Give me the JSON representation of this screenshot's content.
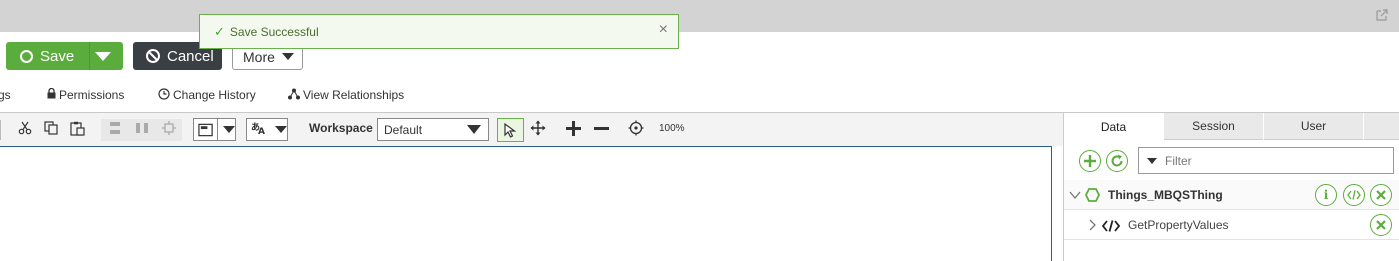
{
  "toast": {
    "message": "Save Successful",
    "close_glyph": "×"
  },
  "actions": {
    "save_label": "Save",
    "cancel_label": "Cancel",
    "more_label": "More"
  },
  "nav_tabs": [
    {
      "label": "gs",
      "icon": ""
    },
    {
      "label": "Permissions",
      "icon": "lock-icon"
    },
    {
      "label": "Change History",
      "icon": "clock-icon"
    },
    {
      "label": "View Relationships",
      "icon": "relationships-icon"
    }
  ],
  "toolbar": {
    "workspace_label": "Workspace",
    "workspace_value": "Default",
    "zoom": "100%"
  },
  "panel": {
    "tabs": [
      "Data",
      "Session",
      "User"
    ],
    "filter_placeholder": "Filter",
    "thing_name": "Things_MBQSThing",
    "service_name": "GetPropertyValues"
  },
  "colors": {
    "accent": "#5aad3c",
    "dark": "#3a3f44",
    "canvas_border": "#2a5d8c"
  }
}
